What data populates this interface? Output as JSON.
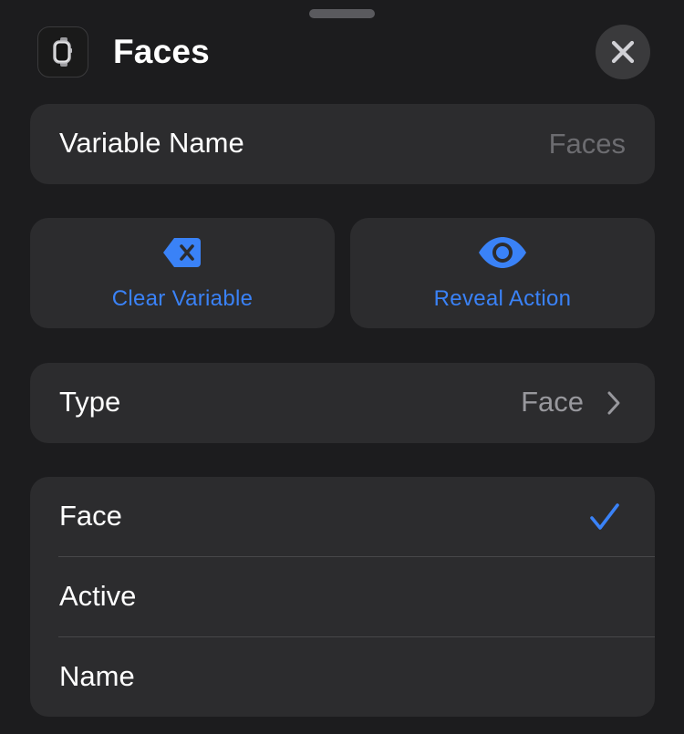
{
  "header": {
    "title": "Faces",
    "app_icon": "watch-face-icon",
    "close_icon": "close-icon"
  },
  "variable": {
    "label": "Variable Name",
    "placeholder": "Faces",
    "value": ""
  },
  "actions": [
    {
      "label": "Clear Variable",
      "icon": "backspace-icon"
    },
    {
      "label": "Reveal Action",
      "icon": "eye-icon"
    }
  ],
  "type_row": {
    "label": "Type",
    "value": "Face",
    "icon": "chevron-right-icon"
  },
  "properties": [
    {
      "label": "Face",
      "selected": true
    },
    {
      "label": "Active",
      "selected": false
    },
    {
      "label": "Name",
      "selected": false
    }
  ],
  "colors": {
    "background": "#1c1c1e",
    "card": "#2c2c2e",
    "accent": "#3a82f7",
    "secondary_text": "#98989d"
  }
}
